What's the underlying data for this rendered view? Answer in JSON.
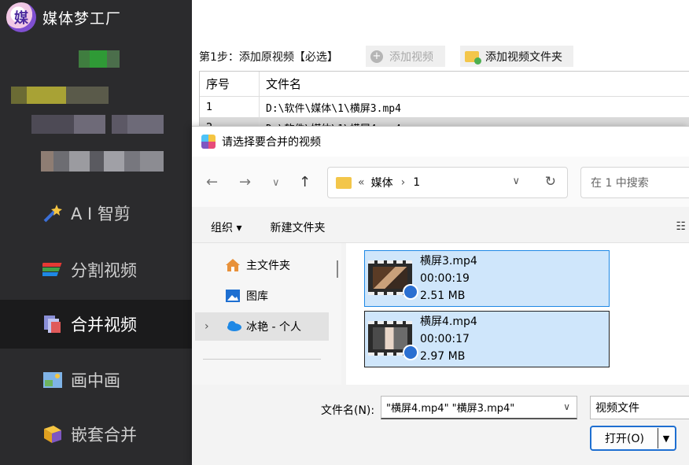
{
  "app": {
    "title": "媒体梦工厂",
    "logo_text": "媒"
  },
  "sidebar": {
    "items": [
      {
        "label": "A I 智剪",
        "icon": "ai-wand-icon"
      },
      {
        "label": "分割视频",
        "icon": "split-video-icon"
      },
      {
        "label": "合并视频",
        "icon": "merge-video-icon",
        "active": true
      },
      {
        "label": "画中画",
        "icon": "picture-in-picture-icon"
      },
      {
        "label": "嵌套合并",
        "icon": "nested-merge-icon"
      }
    ]
  },
  "main": {
    "step_label": "第1步：添加原视频【必选】",
    "add_video_button": "添加视频",
    "add_folder_button": "添加视频文件夹",
    "table": {
      "headers": [
        "序号",
        "文件名"
      ],
      "rows": [
        {
          "index": "1",
          "file": "D:\\软件\\媒体\\1\\横屏3.mp4"
        },
        {
          "index": "2",
          "file": "D:\\软件\\媒体\\1\\横屏4.mp4"
        }
      ]
    }
  },
  "dialog": {
    "title": "请选择要合并的视频",
    "nav": {
      "back": "←",
      "forward": "→",
      "recent": "∨",
      "up": "↑"
    },
    "address": {
      "prefix": "«",
      "path1": "媒体",
      "sep": "›",
      "path2": "1"
    },
    "search_placeholder": "在 1 中搜索",
    "toolbar": {
      "organize": "组织 ▾",
      "new_folder": "新建文件夹"
    },
    "nav_pane": [
      {
        "label": "主文件夹",
        "icon": "home-icon"
      },
      {
        "label": "图库",
        "icon": "gallery-icon"
      },
      {
        "label": "冰艳 - 个人",
        "icon": "onedrive-cloud-icon",
        "expander": "›"
      }
    ],
    "files": [
      {
        "name": "横屏3.mp4",
        "duration": "00:00:19",
        "size": "2.51 MB"
      },
      {
        "name": "横屏4.mp4",
        "duration": "00:00:17",
        "size": "2.97 MB"
      }
    ],
    "filename_label": "文件名(N):",
    "filename_value": "\"横屏4.mp4\" \"横屏3.mp4\"",
    "filetype_value": "视频文件",
    "open_button": "打开(O)"
  },
  "colors": {
    "sidebar_bg": "#2b2b2d",
    "sidebar_active": "#1b1b1c",
    "selection_bg": "#cfe6fb",
    "selection_border": "#1e88e5",
    "accent": "#1e6fd1"
  }
}
